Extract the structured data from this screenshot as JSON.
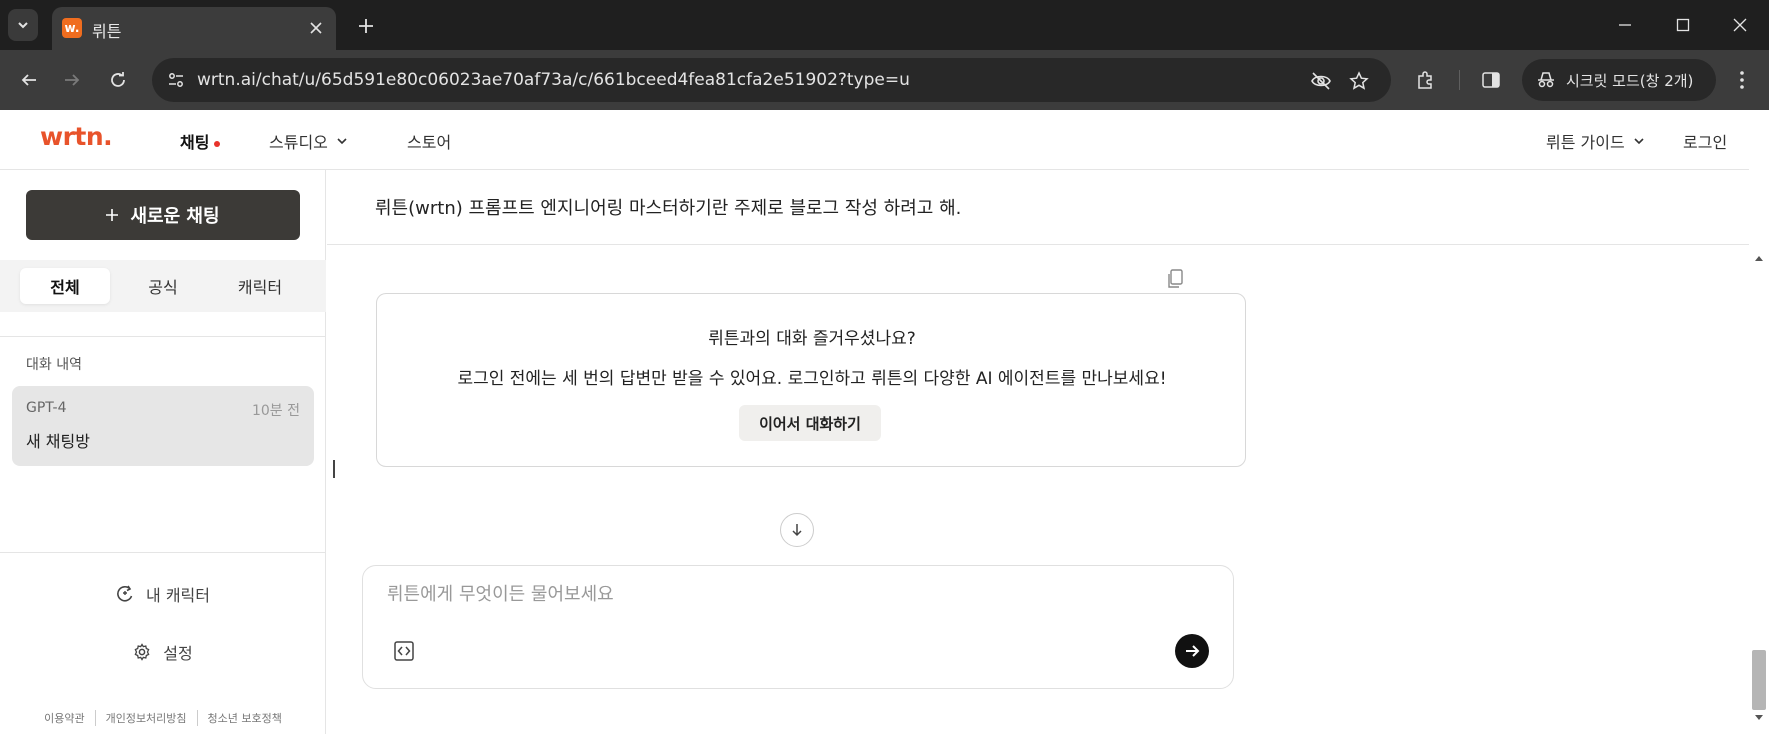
{
  "browser": {
    "tab_title": "뤼튼",
    "favicon_text": "w.",
    "url": "wrtn.ai/chat/u/65d591e80c06023ae70af73a/c/661bceed4fea81cfa2e51902?type=u",
    "incognito_label": "시크릿 모드(창 2개)"
  },
  "nav": {
    "logo": "wrtn.",
    "items": [
      {
        "label": "채팅",
        "active": true
      },
      {
        "label": "스튜디오",
        "active": false
      },
      {
        "label": "스토어",
        "active": false
      }
    ],
    "guide_label": "뤼튼 가이드",
    "login_label": "로그인"
  },
  "sidebar": {
    "new_chat_label": "새로운 채팅",
    "filter_tabs": [
      "전체",
      "공식",
      "캐릭터"
    ],
    "history_label": "대화 내역",
    "history": [
      {
        "model": "GPT-4",
        "time": "10분 전",
        "title": "새 채팅방"
      }
    ],
    "my_character_label": "내 캐릭터",
    "settings_label": "설정",
    "footer_links": [
      "이용약관",
      "개인정보처리방침",
      "청소년 보호정책"
    ]
  },
  "main": {
    "user_prompt": "뤼튼(wrtn) 프롬프트 엔지니어링 마스터하기란 주제로 블로그 작성 하려고 해.",
    "login_card": {
      "line1": "뤼튼과의 대화 즐거우셨나요?",
      "line2": "로그인 전에는 세 번의 답변만 받을 수 있어요. 로그인하고 뤼튼의 다양한 AI 에이전트를 만나보세요!",
      "button_label": "이어서 대화하기"
    },
    "input_placeholder": "뤼튼에게 무엇이든 물어보세요",
    "input_value": ""
  },
  "colors": {
    "brand": "#e8532b",
    "primary_button": "#3c3a37",
    "send_button": "#111111"
  }
}
